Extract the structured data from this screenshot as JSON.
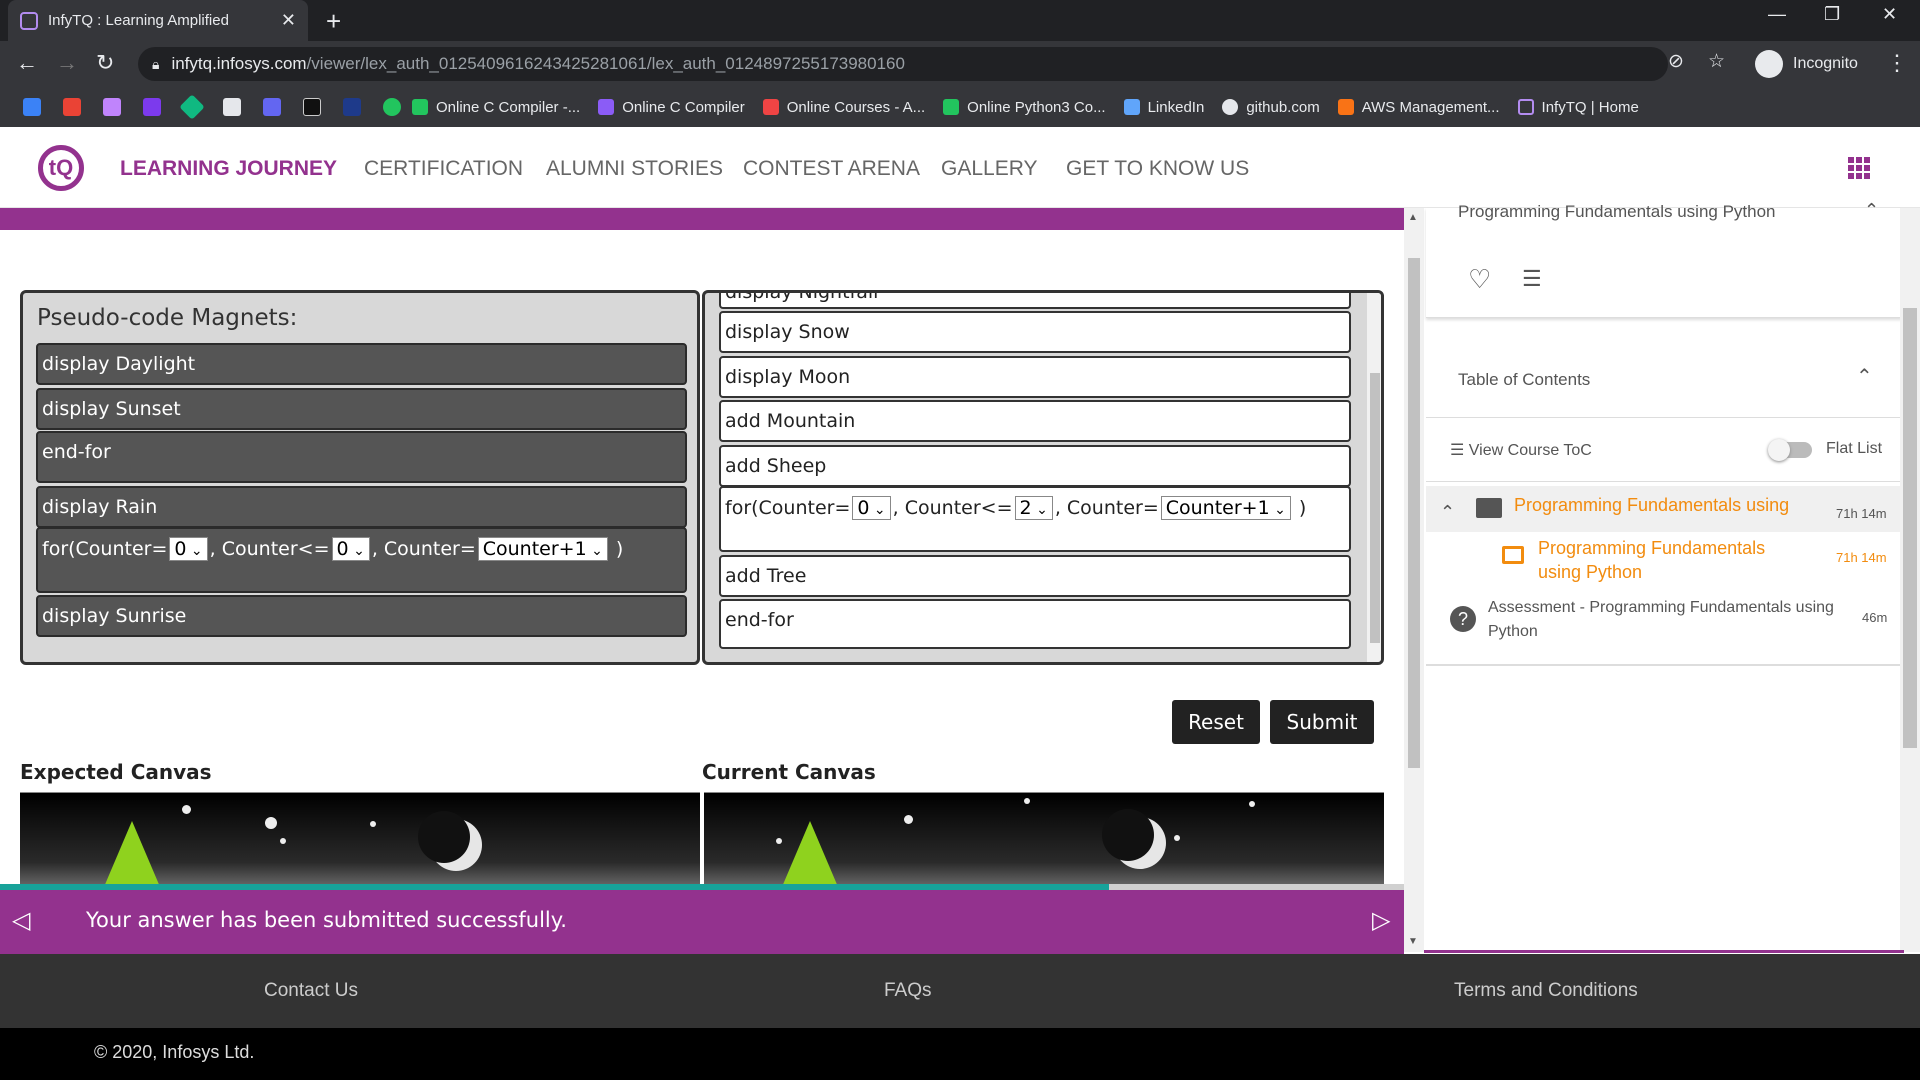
{
  "browser": {
    "tab_title": "InfyTQ : Learning Amplified",
    "tab_close": "✕",
    "new_tab": "+",
    "url_host": "infytq.infosys.com",
    "url_path": "/viewer/lex_auth_012540961624342528106​1/lex_auth_0124897255173980160",
    "incognito_label": "Incognito",
    "window_controls": [
      "—",
      "❐",
      "✕"
    ],
    "bookmarks": [
      {
        "label": "Online C Compiler -...",
        "color": "#22c55e"
      },
      {
        "label": "Online C Compiler",
        "color": "#8b5cf6"
      },
      {
        "label": "Online Courses - A...",
        "color": "#ef4444"
      },
      {
        "label": "Online Python3 Co...",
        "color": "#22c55e"
      },
      {
        "label": "LinkedIn",
        "color": "#60a5fa"
      },
      {
        "label": "github.com",
        "color": "#e5e7eb"
      },
      {
        "label": "AWS Management...",
        "color": "#f97316"
      },
      {
        "label": "InfyTQ | Home",
        "color": "#b38cf0"
      }
    ]
  },
  "site": {
    "logo_text": "tQ",
    "nav": [
      "LEARNING JOURNEY",
      "CERTIFICATION",
      "ALUMNI STORIES",
      "CONTEST ARENA",
      "GALLERY",
      "GET TO KNOW US"
    ],
    "accent_color": "#93328e"
  },
  "exercise": {
    "magnets_title": "Pseudo-code Magnets:",
    "left_magnets": [
      "display Daylight",
      "display Sunset",
      "end-for",
      "display Rain",
      "display Sunrise"
    ],
    "left_for": {
      "prefix": "for(Counter=",
      "start": "0",
      "mid1": ", Counter<=",
      "end": "0",
      "mid2": ", Counter=",
      "step": "Counter+1",
      "suffix": " )"
    },
    "right_partial": "display Nightfall",
    "right_items": [
      "display Snow",
      "display Moon",
      "add Mountain",
      "add Sheep"
    ],
    "right_for": {
      "prefix": "for(Counter=",
      "start": "0",
      "mid1": ", Counter<=",
      "end": "2",
      "mid2": ", Counter=",
      "step": "Counter+1",
      "suffix": " )"
    },
    "right_items_after": [
      "add Tree",
      "end-for"
    ],
    "reset_label": "Reset",
    "submit_label": "Submit",
    "expected_canvas_label": "Expected Canvas",
    "current_canvas_label": "Current Canvas",
    "progress_fraction": 0.79,
    "status_message": "Your answer has been submitted successfully."
  },
  "sidebar": {
    "course_title": "Programming Fundamentals using Python",
    "toc_title": "Table of Contents",
    "view_toc": "View Course ToC",
    "flat_list": "Flat List",
    "items": [
      {
        "title": "Programming Fundamentals using Python",
        "duration": "71h 14m"
      },
      {
        "title": "Programming Fundamentals using Python",
        "duration": "71h 14m"
      },
      {
        "title": "Assessment - Programming Fundamentals using Python",
        "duration": "46m"
      }
    ]
  },
  "footer": {
    "contact": "Contact Us",
    "faqs": "FAQs",
    "terms": "Terms and Conditions",
    "copyright": "© 2020, Infosys Ltd."
  }
}
